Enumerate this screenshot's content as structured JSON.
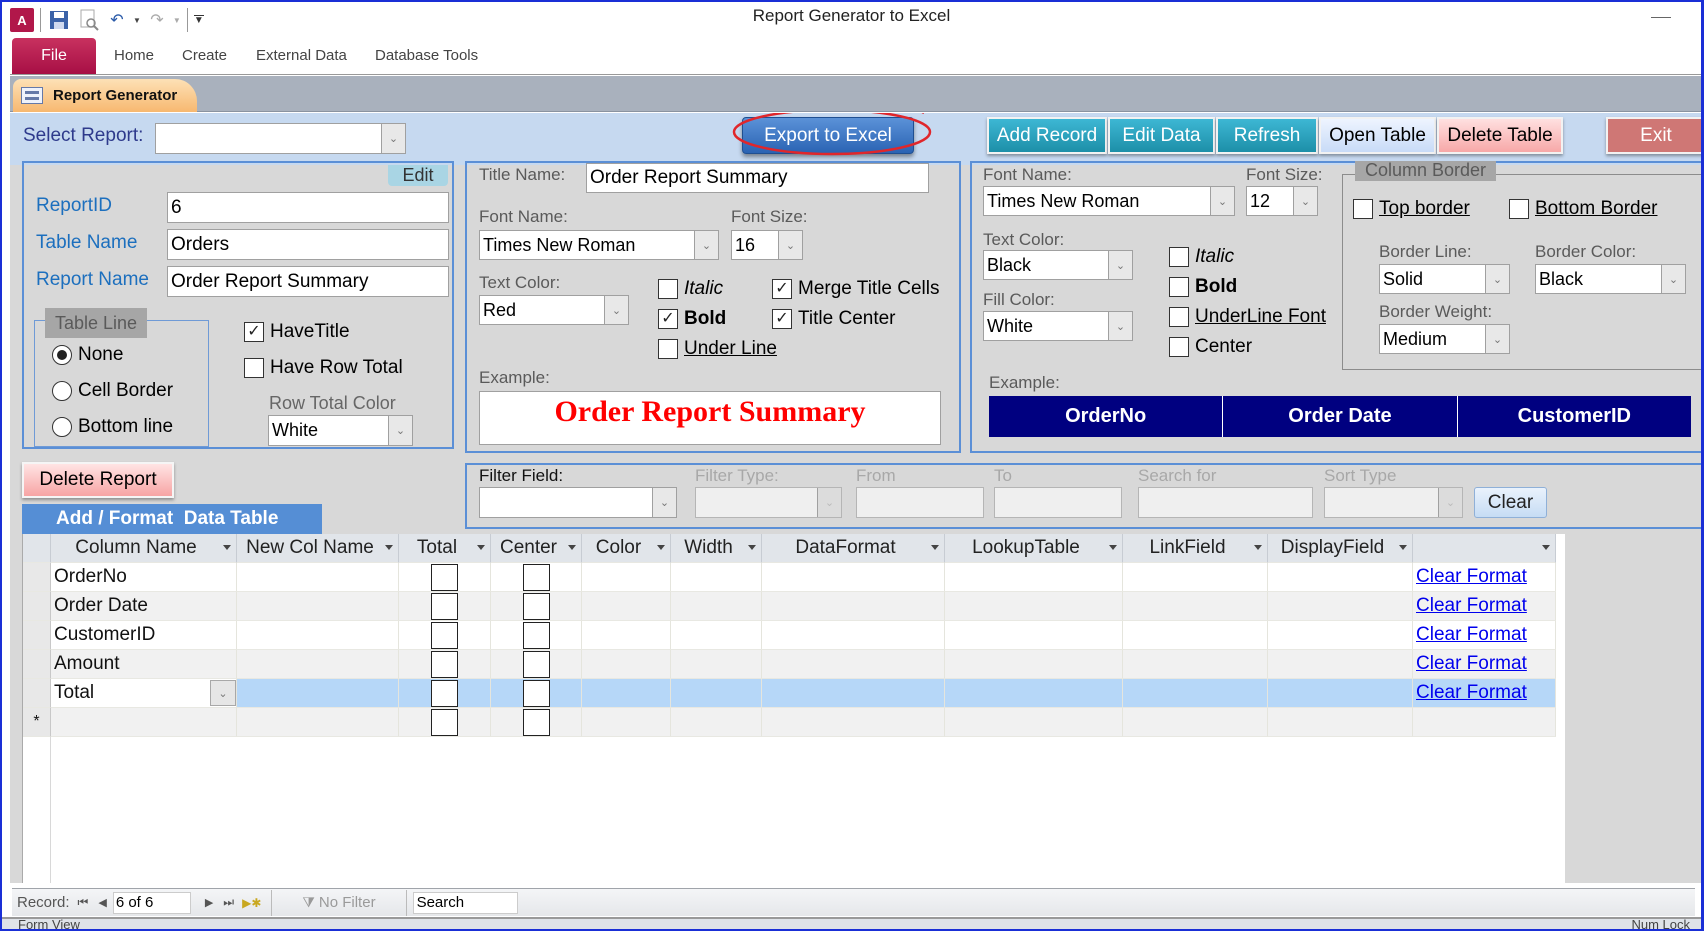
{
  "window": {
    "title": "Report Generator to Excel",
    "quick_access": [
      "access-app-icon",
      "save-icon",
      "print-preview-icon",
      "undo-icon",
      "redo-icon",
      "customize-qat-icon"
    ]
  },
  "ribbon": {
    "tabs": [
      "File",
      "Home",
      "Create",
      "External Data",
      "Database Tools"
    ]
  },
  "document_tab": {
    "label": "Report Generator"
  },
  "header": {
    "select_report_label": "Select Report:",
    "select_report_value": "",
    "export_button": "Export to Excel",
    "buttons": [
      "Add Record",
      "Edit Data",
      "Refresh",
      "Open Table",
      "Delete Table"
    ],
    "exit_button": "Exit",
    "annotation_color": "#e0262b"
  },
  "report_panel": {
    "edit_button": "Edit",
    "report_id_label": "ReportID",
    "report_id": "6",
    "table_name_label": "Table Name",
    "table_name": "Orders",
    "report_name_label": "Report Name",
    "report_name": "Order Report Summary",
    "table_line": {
      "title": "Table Line",
      "options": [
        "None",
        "Cell Border",
        "Bottom line"
      ],
      "selected": "None"
    },
    "have_title_label": "HaveTitle",
    "have_title": true,
    "have_row_total_label": "Have Row Total",
    "have_row_total": false,
    "row_total_color_label": "Row Total Color",
    "row_total_color": "White"
  },
  "title_panel": {
    "title_name_label": "Title Name:",
    "title_name": "Order Report Summary",
    "font_name_label": "Font Name:",
    "font_name": "Times New Roman",
    "font_size_label": "Font Size:",
    "font_size": "16",
    "text_color_label": "Text Color:",
    "text_color": "Red",
    "italic_label": "Italic",
    "italic": false,
    "bold_label": "Bold",
    "bold": true,
    "underline_label": "Under Line",
    "underline": false,
    "merge_label": "Merge Title Cells",
    "merge": true,
    "center_label": "Title Center",
    "center": true,
    "example_label": "Example:",
    "example_text": "Order Report Summary",
    "example_color": "#ff0000"
  },
  "column_panel": {
    "font_name_label": "Font Name:",
    "font_name": "Times New Roman",
    "font_size_label": "Font Size:",
    "font_size": "12",
    "text_color_label": "Text Color:",
    "text_color": "Black",
    "fill_color_label": "Fill Color:",
    "fill_color": "White",
    "italic_label": "Italic",
    "italic": false,
    "bold_label": "Bold",
    "bold": false,
    "underline_label": "UnderLine Font",
    "underline": false,
    "center_label": "Center",
    "center": false,
    "border": {
      "title": "Column Border",
      "top_label": "Top border",
      "top": false,
      "bottom_label": "Bottom Border",
      "bottom": false,
      "line_label": "Border Line:",
      "line": "Solid",
      "color_label": "Border Color:",
      "color": "Black",
      "weight_label": "Border Weight:",
      "weight": "Medium"
    },
    "example_label": "Example:",
    "example_headers": [
      "OrderNo",
      "Order Date",
      "CustomerID"
    ],
    "example_fill": "#000080"
  },
  "delete_report_button": "Delete Report",
  "section_banner": "Add / Format  Data Table",
  "filter": {
    "filter_field_label": "Filter Field:",
    "filter_field": "",
    "filter_type_label": "Filter Type:",
    "from_label": "From",
    "to_label": "To",
    "search_for_label": "Search for",
    "sort_type_label": "Sort Type",
    "clear_button": "Clear"
  },
  "datasheet": {
    "columns": [
      "Column Name",
      "New Col Name",
      "Total",
      "Center",
      "Color",
      "Width",
      "DataFormat",
      "LookupTable",
      "LinkField",
      "DisplayField",
      ""
    ],
    "rows": [
      {
        "column_name": "OrderNo",
        "link": "Clear Format"
      },
      {
        "column_name": "Order Date",
        "link": "Clear Format"
      },
      {
        "column_name": "CustomerID",
        "link": "Clear Format"
      },
      {
        "column_name": "Amount",
        "link": "Clear Format"
      },
      {
        "column_name": "Total",
        "link": "Clear Format",
        "current": true
      }
    ],
    "new_row_marker": "*"
  },
  "navigation": {
    "record_label": "Record:",
    "position": "6 of 6",
    "filter_status": "No Filter",
    "search_placeholder": "Search"
  },
  "status_bar": {
    "left": "Form View",
    "right": "Num Lock"
  }
}
